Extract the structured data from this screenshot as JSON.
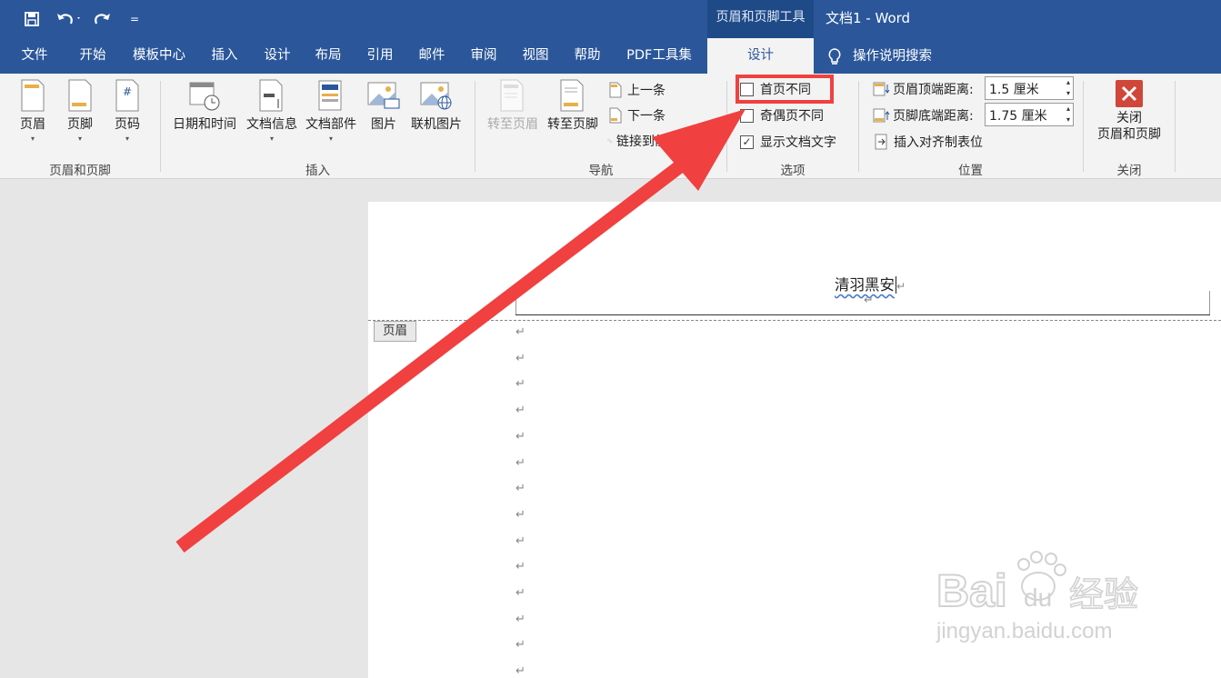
{
  "title_bar": {
    "context_title": "页眉和页脚工具",
    "doc_title": "文档1  -  Word"
  },
  "qat": {
    "save_icon": "save-icon",
    "undo_icon": "undo-icon",
    "redo_icon": "redo-icon",
    "customize": "="
  },
  "tabs": {
    "file": "文件",
    "home": "开始",
    "template": "模板中心",
    "insert": "插入",
    "design": "设计",
    "layout": "布局",
    "references": "引用",
    "mailings": "邮件",
    "review": "审阅",
    "view": "视图",
    "help": "帮助",
    "pdf": "PDF工具集",
    "ctx_design": "设计",
    "tell_me": "操作说明搜索"
  },
  "ribbon": {
    "hf_group": {
      "label": "页眉和页脚",
      "header": "页眉",
      "footer": "页脚",
      "page_number": "页码"
    },
    "insert_group": {
      "label": "插入",
      "datetime": "日期和时间",
      "docinfo": "文档信息",
      "quickparts": "文档部件",
      "picture": "图片",
      "online_picture": "联机图片"
    },
    "nav_group": {
      "label": "导航",
      "goto_header": "转至页眉",
      "goto_footer": "转至页脚",
      "previous": "上一条",
      "next": "下一条",
      "link_prev": "链接到前一节"
    },
    "options_group": {
      "label": "选项",
      "diff_first": "首页不同",
      "diff_odd_even": "奇偶页不同",
      "show_doc_text": "显示文档文字"
    },
    "position_group": {
      "label": "位置",
      "header_top_label": "页眉顶端距离:",
      "header_top_value": "1.5 厘米",
      "footer_bottom_label": "页脚底端距离:",
      "footer_bottom_value": "1.75 厘米",
      "insert_align_tab": "插入对齐制表位"
    },
    "close_group": {
      "label": "关闭",
      "close_line1": "关闭",
      "close_line2": "页眉和页脚"
    }
  },
  "document": {
    "header_text": "清羽黑安",
    "header_tag": "页眉",
    "para_mark": "↵"
  },
  "watermark": {
    "brand": "Bai du 经验",
    "url": "jingyan.baidu.com"
  },
  "colors": {
    "accent": "#2b579a",
    "annotation": "#f04040"
  }
}
